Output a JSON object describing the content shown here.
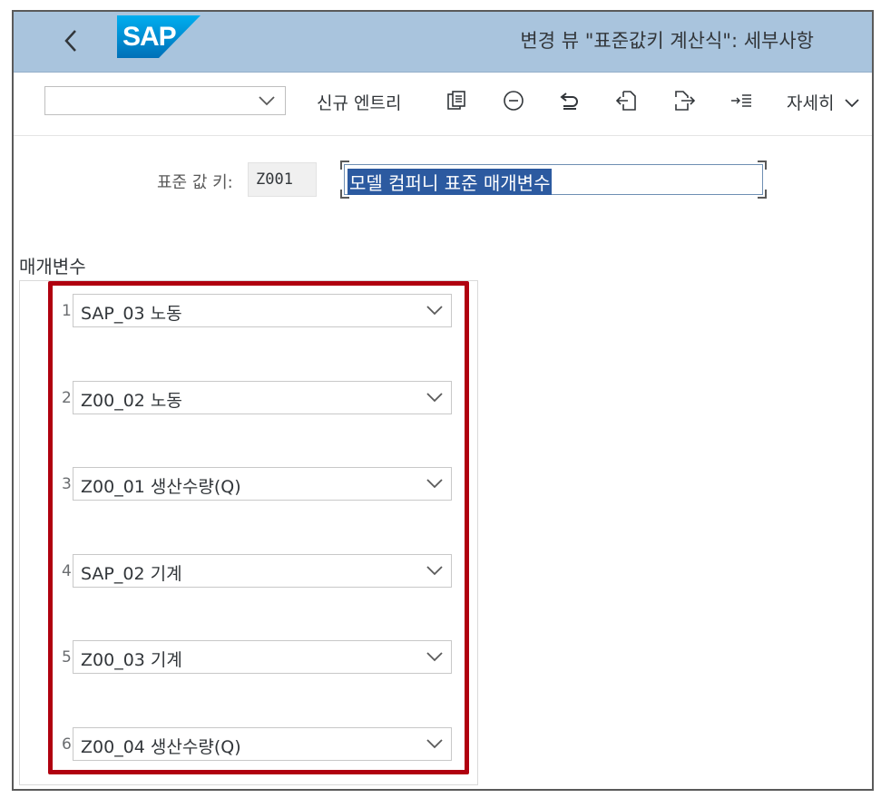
{
  "shell": {
    "title": "변경 뷰 \"표준값키 계산식\": 세부사항",
    "logo_text": "SAP"
  },
  "toolbar": {
    "select_value": "",
    "new_entry": "신규 엔트리",
    "more": "자세히"
  },
  "header": {
    "key_label": "표준 값 키:",
    "key_value": "Z001",
    "description": "모델 컴퍼니 표준 매개변수"
  },
  "parameters": {
    "section_label": "매개변수",
    "rows": [
      {
        "num": "1",
        "value": "SAP_03 노동"
      },
      {
        "num": "2",
        "value": "Z00_02 노동"
      },
      {
        "num": "3",
        "value": "Z00_01 생산수량(Q)"
      },
      {
        "num": "4",
        "value": "SAP_02 기계"
      },
      {
        "num": "5",
        "value": "Z00_03 기계"
      },
      {
        "num": "6",
        "value": "Z00_04 생산수량(Q)"
      }
    ]
  },
  "colors": {
    "shell_bg": "#a9c4dd",
    "highlight_border": "#b0000f",
    "selection_bg": "#2c5aa0"
  }
}
